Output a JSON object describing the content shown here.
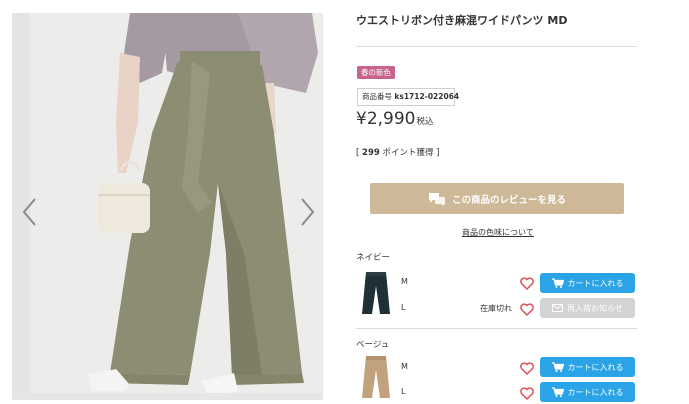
{
  "product": {
    "title": "ウエストリボン付き麻混ワイドパンツ MD",
    "badge": "春の新色",
    "sku_label": "商品番号",
    "sku_value": "ks1712-022064",
    "price": "¥2,990",
    "price_tax": "税込",
    "points_prefix": "[ ",
    "points_value": "299",
    "points_suffix": " ポイント獲得 ]",
    "review_button": "この商品のレビューを見る",
    "color_link": "商品の色味について"
  },
  "colors": [
    {
      "name": "ネイビー",
      "rows": [
        {
          "size": "M",
          "stock": "",
          "action": "カートに入れる",
          "action_type": "cart"
        },
        {
          "size": "L",
          "stock": "在庫切れ",
          "action": "再入荷お知らせ",
          "action_type": "notify"
        }
      ]
    },
    {
      "name": "ベージュ",
      "rows": [
        {
          "size": "M",
          "stock": "",
          "action": "カートに入れる",
          "action_type": "cart"
        },
        {
          "size": "L",
          "stock": "",
          "action": "カートに入れる",
          "action_type": "cart"
        }
      ]
    }
  ],
  "icons": {
    "prev": "chevron-left-icon",
    "next": "chevron-right-icon",
    "review": "chat-bubbles-icon",
    "favorite": "heart-icon",
    "cart": "cart-icon",
    "mail": "mail-icon"
  },
  "theme": {
    "accent_blue": "#2aa4e6",
    "review_beige": "#cdb897",
    "badge_pink": "#c8638c",
    "heart_red": "#e0454f",
    "disabled_grey": "#d3d3d3"
  }
}
